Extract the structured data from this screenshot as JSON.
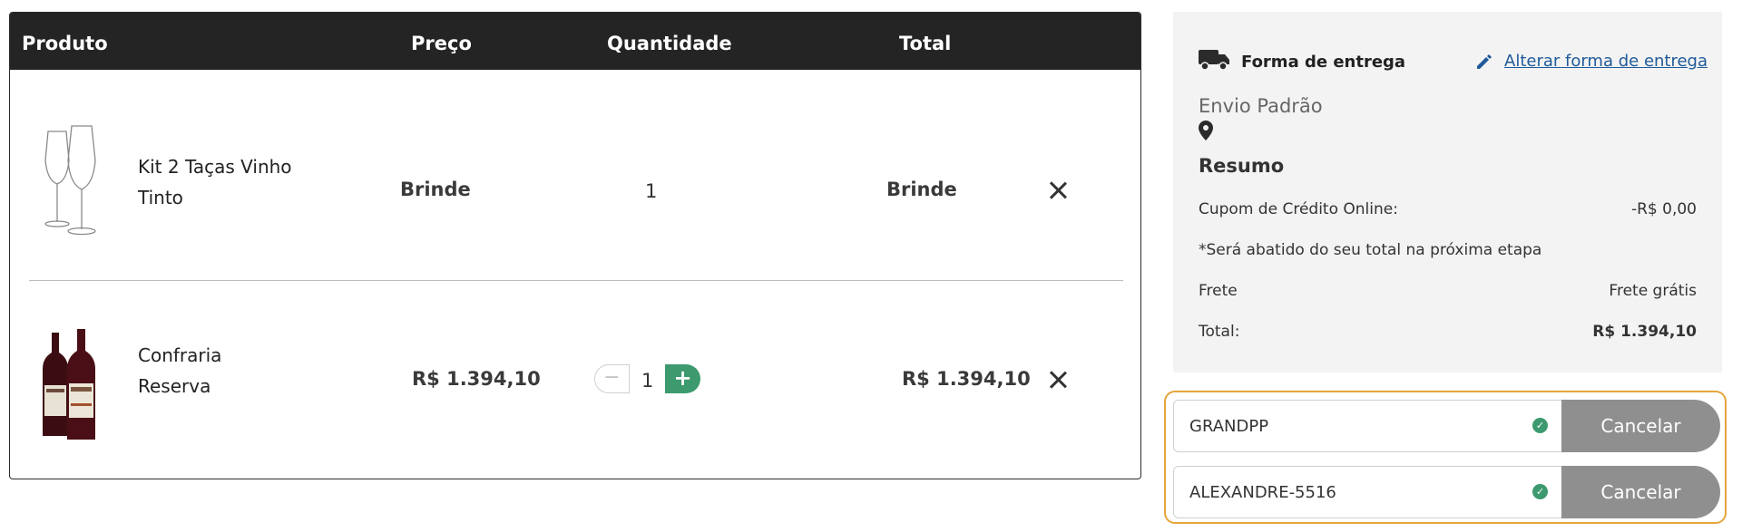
{
  "cart": {
    "headers": {
      "product": "Produto",
      "price": "Preço",
      "quantity": "Quantidade",
      "total": "Total"
    },
    "items": [
      {
        "name_line1": "Kit 2 Taças Vinho",
        "name_line2": "Tinto",
        "price": "Brinde",
        "quantity": "1",
        "total": "Brinde",
        "image": "wine-glasses-image"
      },
      {
        "name_line1": "Confraria",
        "name_line2": "Reserva",
        "price": "R$ 1.394,10",
        "quantity": "1",
        "total": "R$ 1.394,10",
        "image": "wine-bottles-image",
        "stepper": {
          "minus": "−",
          "plus": "+"
        }
      }
    ]
  },
  "shipping": {
    "title": "Forma de entrega",
    "change_link": "Alterar forma de entrega",
    "method": "Envio Padrão"
  },
  "summary": {
    "title": "Resumo",
    "coupon_label": "Cupom de Crédito Online:",
    "coupon_value": "-R$ 0,00",
    "note": "*Será abatido do seu total na próxima etapa",
    "shipping_label": "Frete",
    "shipping_value": "Frete grátis",
    "total_label": "Total:",
    "total_value": "R$ 1.394,10"
  },
  "coupons": [
    {
      "code": "GRANDPP",
      "cancel_label": "Cancelar"
    },
    {
      "code": "ALEXANDRE-5516",
      "cancel_label": "Cancelar"
    }
  ],
  "colors": {
    "header_bg": "#242424",
    "accent_green": "#3d9a6e",
    "link_blue": "#1f5a9a",
    "coupon_border": "#e6a53b",
    "cancel_bg": "#8f8f8f",
    "panel_bg": "#f3f3f3"
  }
}
